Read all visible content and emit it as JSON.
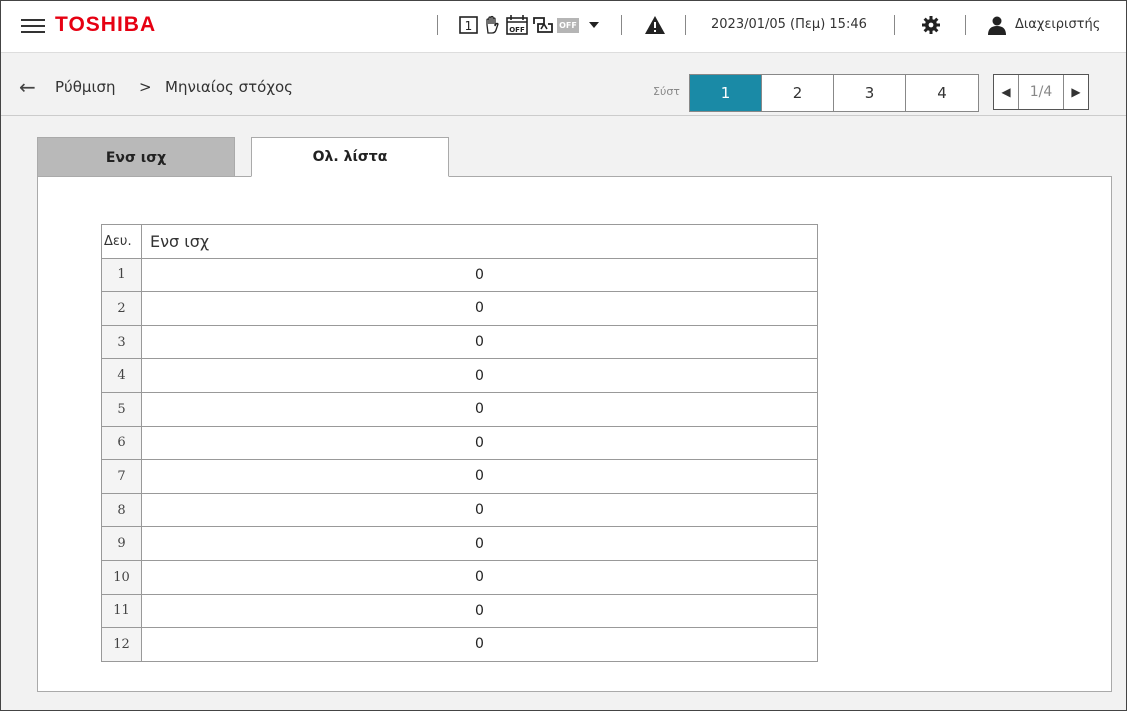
{
  "header": {
    "logo": "TOSHIBA",
    "off_badge": "OFF",
    "datetime": "2023/01/05 (Πεμ) 15:46",
    "user": "Διαχειριστής",
    "colors": {
      "logo": "#e60012",
      "accent": "#1a8aa6"
    }
  },
  "breadcrumb": {
    "items": [
      "Ρύθμιση",
      "Μηνιαίος στόχος"
    ],
    "separator": ">"
  },
  "systems": {
    "label": "Σύστ",
    "tabs": [
      "1",
      "2",
      "3",
      "4"
    ],
    "active": "1"
  },
  "pager": {
    "text": "1/4"
  },
  "tabs": {
    "tab1": "Ενσ ισχ",
    "tab2": "Ολ. λίστα",
    "active": "Ολ. λίστα"
  },
  "table": {
    "headers": [
      "Δευ.",
      "Ενσ ισχ"
    ],
    "rows": [
      [
        "1",
        "0"
      ],
      [
        "2",
        "0"
      ],
      [
        "3",
        "0"
      ],
      [
        "4",
        "0"
      ],
      [
        "5",
        "0"
      ],
      [
        "6",
        "0"
      ],
      [
        "7",
        "0"
      ],
      [
        "8",
        "0"
      ],
      [
        "9",
        "0"
      ],
      [
        "10",
        "0"
      ],
      [
        "11",
        "0"
      ],
      [
        "12",
        "0"
      ]
    ]
  },
  "icons": [
    "menu-icon",
    "schedule-1-icon",
    "hand-icon",
    "calendar-off-icon",
    "timer-off-icon",
    "dropdown-icon",
    "warning-icon",
    "gear-icon",
    "user-icon",
    "back-arrow-icon",
    "prev-page-icon",
    "next-page-icon"
  ]
}
